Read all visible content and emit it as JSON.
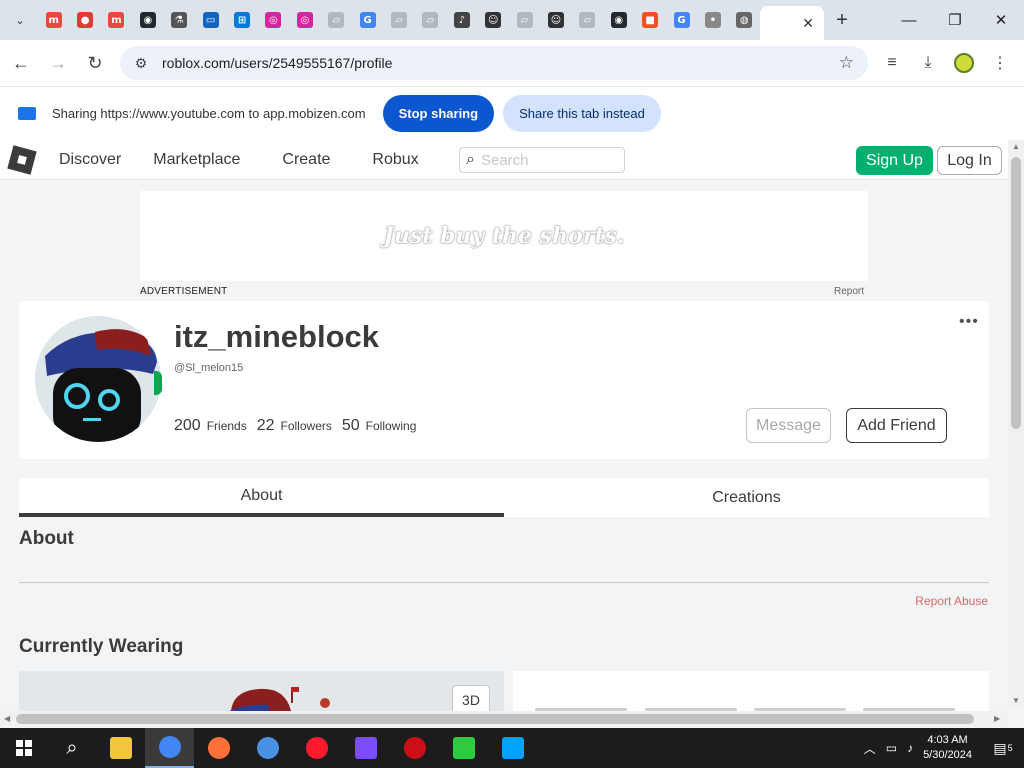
{
  "browser": {
    "tabs": [
      {
        "icon": "mobizen-icon",
        "color": "#e5483c",
        "glyph": "m"
      },
      {
        "icon": "record-icon",
        "color": "#e53935",
        "glyph": "●"
      },
      {
        "icon": "mobizen-icon",
        "color": "#e5483c",
        "glyph": "m"
      },
      {
        "icon": "github-icon",
        "color": "#24292f",
        "glyph": "◉"
      },
      {
        "icon": "flask-icon",
        "color": "#555555",
        "glyph": "⚗"
      },
      {
        "icon": "screen-icon",
        "color": "#1565c0",
        "glyph": "▭"
      },
      {
        "icon": "windows-icon",
        "color": "#0078d4",
        "glyph": "⊞"
      },
      {
        "icon": "instagram-icon",
        "color": "#d6249f",
        "glyph": "◎"
      },
      {
        "icon": "instagram-icon",
        "color": "#d6249f",
        "glyph": "◎"
      },
      {
        "icon": "page-icon",
        "color": "#b0b8c0",
        "glyph": "▱"
      },
      {
        "icon": "google-icon",
        "color": "#4285f4",
        "glyph": "G"
      },
      {
        "icon": "page-icon",
        "color": "#b0b8c0",
        "glyph": "▱"
      },
      {
        "icon": "page-icon",
        "color": "#b0b8c0",
        "glyph": "▱"
      },
      {
        "icon": "speaker-icon",
        "color": "#444444",
        "glyph": "♪"
      },
      {
        "icon": "user-icon",
        "color": "#333333",
        "glyph": "☺"
      },
      {
        "icon": "page-icon",
        "color": "#b0b8c0",
        "glyph": "▱"
      },
      {
        "icon": "user-icon",
        "color": "#333333",
        "glyph": "☺"
      },
      {
        "icon": "page-icon",
        "color": "#b0b8c0",
        "glyph": "▱"
      },
      {
        "icon": "github-icon",
        "color": "#24292f",
        "glyph": "◉"
      },
      {
        "icon": "microsoft-icon",
        "color": "#f25022",
        "glyph": "■"
      },
      {
        "icon": "google-icon",
        "color": "#4285f4",
        "glyph": "G"
      },
      {
        "icon": "dots-icon",
        "color": "#888888",
        "glyph": "•"
      },
      {
        "icon": "globe-icon",
        "color": "#666666",
        "glyph": "◍"
      }
    ],
    "active_tab_close": "✕",
    "new_tab": "+",
    "window": {
      "minimize": "—",
      "maximize": "❐",
      "close": "✕"
    },
    "url": "roblox.com/users/2549555167/profile",
    "back": "←",
    "forward": "→",
    "reload": "↻",
    "star": "☆"
  },
  "sharing_bar": {
    "message": "Sharing https://www.youtube.com to app.mobizen.com",
    "stop_label": "Stop sharing",
    "share_tab_label": "Share this tab instead"
  },
  "roblox_nav": {
    "links": [
      "Discover",
      "Marketplace",
      "Create",
      "Robux"
    ],
    "search_placeholder": "Search",
    "signup_label": "Sign Up",
    "login_label": "Log In"
  },
  "ad": {
    "text": "Just buy the shorts.",
    "label": "ADVERTISEMENT",
    "report": "Report"
  },
  "profile": {
    "username": "itz_mineblock",
    "handle": "@Sl_melon15",
    "friends_count": "200",
    "friends_label": "Friends",
    "followers_count": "22",
    "followers_label": "Followers",
    "following_count": "50",
    "following_label": "Following",
    "more": "•••",
    "message_label": "Message",
    "add_friend_label": "Add Friend"
  },
  "profile_tabs": [
    "About",
    "Creations"
  ],
  "about": {
    "heading": "About",
    "report_abuse": "Report Abuse"
  },
  "wearing": {
    "heading": "Currently Wearing",
    "btn_3d": "3D"
  },
  "taskbar": {
    "time": "4:03 AM",
    "date": "5/30/2024",
    "notifications": "5",
    "apps": [
      {
        "name": "file-explorer-icon",
        "color": "#f3c53c"
      },
      {
        "name": "chrome-icon",
        "color": "#4285f4",
        "active": true
      },
      {
        "name": "firefox-icon",
        "color": "#ff7139"
      },
      {
        "name": "chromium-icon",
        "color": "#4a90e2"
      },
      {
        "name": "opera-icon",
        "color": "#ff1b2d"
      },
      {
        "name": "wavebox-icon",
        "color": "#7b4dff"
      },
      {
        "name": "opera-gx-icon",
        "color": "#cc0f16"
      },
      {
        "name": "n-app-icon",
        "color": "#2ecc40"
      },
      {
        "name": "roblox-studio-icon",
        "color": "#00a2ff"
      }
    ]
  }
}
